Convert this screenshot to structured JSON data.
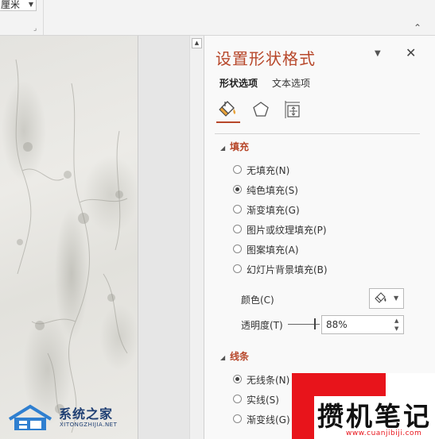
{
  "ribbon": {
    "unit_value": "厘米",
    "launcher_glyph": "⌟",
    "collapse_glyph": "⌃"
  },
  "scrollbar": {
    "up_glyph": "▲"
  },
  "pane": {
    "title": "设置形状格式",
    "menu_glyph": "▼",
    "close_glyph": "✕",
    "tabs": [
      {
        "label": "形状选项",
        "active": true
      },
      {
        "label": "文本选项",
        "active": false
      }
    ],
    "category_icons": [
      "fill-line-icon",
      "effects-icon",
      "size-properties-icon"
    ],
    "accent_color": "#b7472a",
    "fill_section": {
      "title": "填充",
      "options": [
        {
          "label": "无填充(N)",
          "checked": false
        },
        {
          "label": "纯色填充(S)",
          "checked": true
        },
        {
          "label": "渐变填充(G)",
          "checked": false
        },
        {
          "label": "图片或纹理填充(P)",
          "checked": false
        },
        {
          "label": "图案填充(A)",
          "checked": false
        },
        {
          "label": "幻灯片背景填充(B)",
          "checked": false
        }
      ],
      "color_label": "颜色(C)",
      "transparency_label": "透明度(T)",
      "transparency_value": "88%",
      "transparency_fraction": 0.88
    },
    "line_section": {
      "title": "线条",
      "options": [
        {
          "label": "无线条(N)",
          "checked": true
        },
        {
          "label": "实线(S)",
          "checked": false
        },
        {
          "label": "渐变线(G)",
          "checked": false
        }
      ]
    }
  },
  "watermarks": {
    "left_name": "系统之家",
    "left_url": "XITONGZHIJIA.NET",
    "right_brand": "攒机笔记",
    "right_url": "www.cuanjibiji.com"
  }
}
